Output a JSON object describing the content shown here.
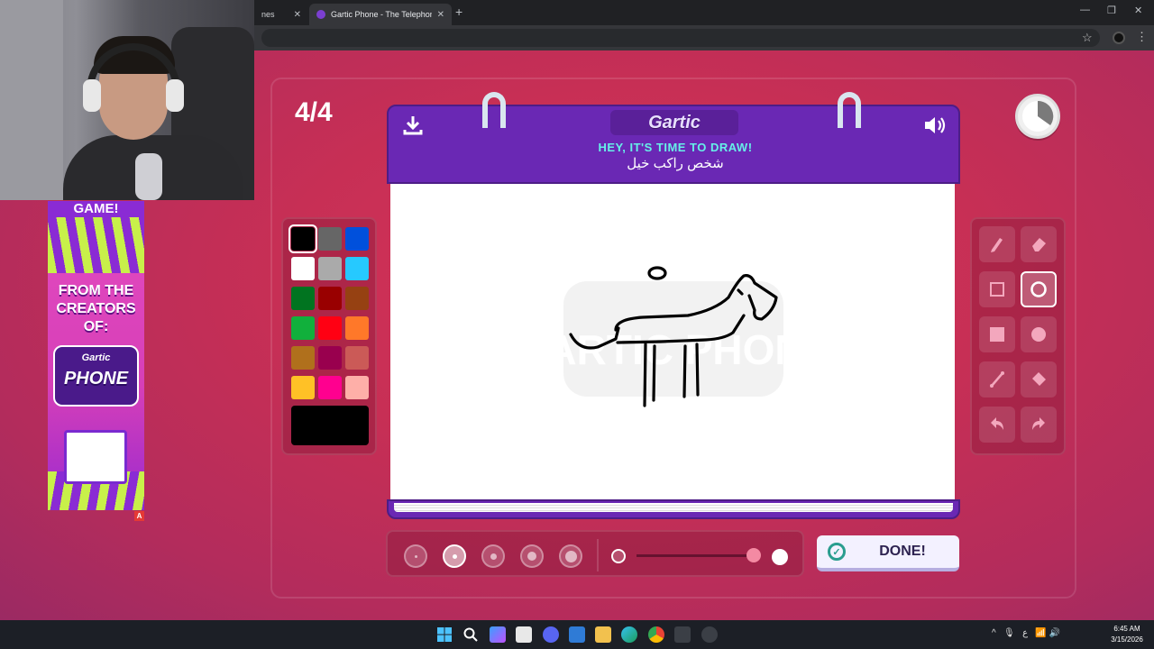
{
  "browser": {
    "tabs": [
      {
        "label": "nes"
      },
      {
        "label": "Gartic Phone - The Telephone Game"
      }
    ],
    "new_tab": "+",
    "close": "✕"
  },
  "game": {
    "round": "4/4",
    "logo": "Gartic",
    "instruction": "HEY, IT'S TIME TO DRAW!",
    "prompt_word": "شخص راكب خيل",
    "done_label": "DONE!",
    "colors": {
      "accent": "#6a28b4",
      "background": "#c72f55",
      "selected_color": "#000000"
    },
    "palette": [
      "#000000",
      "#666666",
      "#0050dc",
      "#ffffff",
      "#aaaaaa",
      "#26c9ff",
      "#017420",
      "#990000",
      "#964112",
      "#11b03c",
      "#ff0013",
      "#ff7829",
      "#b0701c",
      "#99004e",
      "#cb5a57",
      "#ffc126",
      "#ff008f",
      "#feafa8"
    ],
    "tools": [
      {
        "name": "pencil-icon"
      },
      {
        "name": "eraser-icon"
      },
      {
        "name": "rectangle-outline-icon"
      },
      {
        "name": "ellipse-outline-icon"
      },
      {
        "name": "rectangle-filled-icon"
      },
      {
        "name": "ellipse-filled-icon"
      },
      {
        "name": "line-icon"
      },
      {
        "name": "fill-bucket-icon"
      },
      {
        "name": "undo-icon"
      },
      {
        "name": "redo-icon"
      }
    ],
    "selected_tool": "ellipse-outline-icon",
    "brush_sizes": 5,
    "selected_brush": 2,
    "opacity": 1.0,
    "watermark": "GARTIC PHONE"
  },
  "ad": {
    "top_text": "GAME!",
    "creators_text": "FROM THE CREATORS OF:",
    "logo_small": "Gartic",
    "logo_big": "PHONE",
    "badge": "A"
  },
  "taskbar": {
    "time": "6:45 AM",
    "date": "3/15/2026",
    "lang": "ع"
  }
}
